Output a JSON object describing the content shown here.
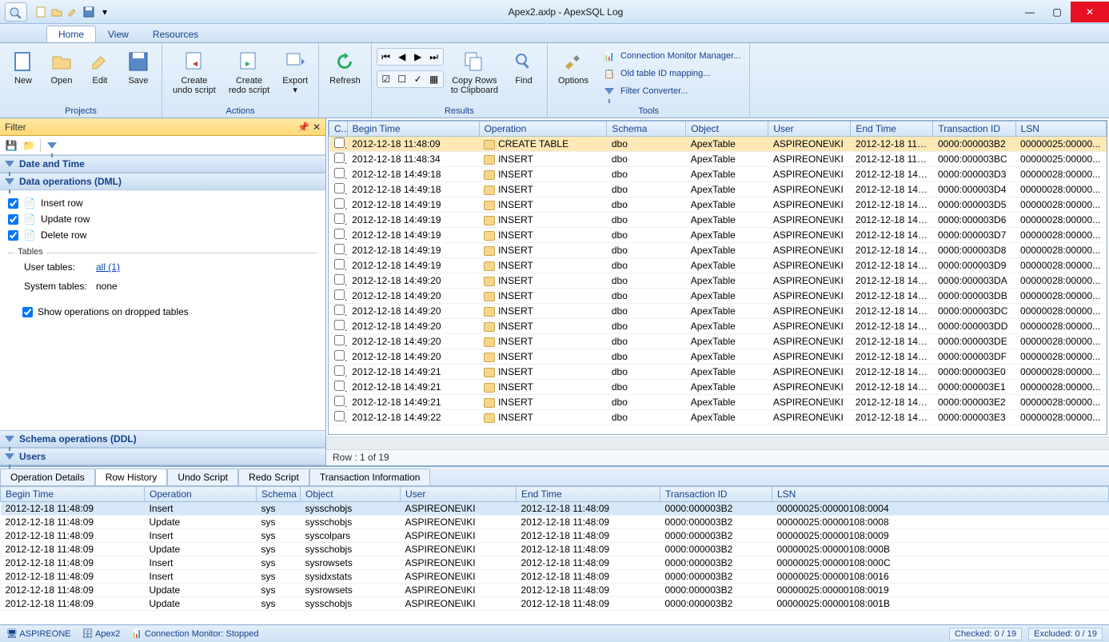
{
  "window": {
    "title": "Apex2.axlp - ApexSQL Log"
  },
  "tabs": [
    {
      "label": "Home",
      "active": true
    },
    {
      "label": "View",
      "active": false
    },
    {
      "label": "Resources",
      "active": false
    }
  ],
  "ribbon": {
    "groups": [
      {
        "label": "Projects",
        "buttons": [
          {
            "label": "New"
          },
          {
            "label": "Open"
          },
          {
            "label": "Edit"
          },
          {
            "label": "Save"
          }
        ]
      },
      {
        "label": "Actions",
        "buttons": [
          {
            "label": "Create\nundo script"
          },
          {
            "label": "Create\nredo script"
          },
          {
            "label": "Export"
          }
        ]
      },
      {
        "label": "",
        "buttons": [
          {
            "label": "Refresh"
          }
        ]
      },
      {
        "label": "Results",
        "buttons": [
          {
            "label": "Copy Rows\nto Clipboard"
          },
          {
            "label": "Find"
          }
        ]
      },
      {
        "label": "Tools",
        "buttons": [
          {
            "label": "Options"
          }
        ],
        "links": [
          {
            "label": "Connection Monitor Manager..."
          },
          {
            "label": "Old table ID mapping..."
          },
          {
            "label": "Filter Converter..."
          }
        ]
      }
    ]
  },
  "filter": {
    "title": "Filter",
    "sections": {
      "date_time": "Date and Time",
      "dml": "Data operations (DML)",
      "ddl": "Schema operations (DDL)",
      "users": "Users"
    },
    "dml_ops": [
      {
        "label": "Insert row",
        "checked": true
      },
      {
        "label": "Update row",
        "checked": true
      },
      {
        "label": "Delete row",
        "checked": true
      }
    ],
    "tables": {
      "label": "Tables",
      "user_tables_key": "User tables:",
      "user_tables_val": "all (1)",
      "system_tables_key": "System tables:",
      "system_tables_val": "none",
      "show_dropped": "Show operations on dropped tables",
      "show_dropped_checked": true
    }
  },
  "grid": {
    "columns": [
      "C...",
      "Begin Time",
      "Operation",
      "Schema",
      "Object",
      "User",
      "End Time",
      "Transaction ID",
      "LSN"
    ],
    "rows": [
      {
        "begin": "2012-12-18 11:48:09",
        "op": "CREATE TABLE",
        "schema": "dbo",
        "object": "ApexTable",
        "user": "ASPIREONE\\IKI",
        "end": "2012-12-18  11:4...",
        "tid": "0000:000003B2",
        "lsn": "00000025:00000...",
        "sel": true
      },
      {
        "begin": "2012-12-18 11:48:34",
        "op": "INSERT",
        "schema": "dbo",
        "object": "ApexTable",
        "user": "ASPIREONE\\IKI",
        "end": "2012-12-18  11:4...",
        "tid": "0000:000003BC",
        "lsn": "00000025:00000..."
      },
      {
        "begin": "2012-12-18 14:49:18",
        "op": "INSERT",
        "schema": "dbo",
        "object": "ApexTable",
        "user": "ASPIREONE\\IKI",
        "end": "2012-12-18  14:4...",
        "tid": "0000:000003D3",
        "lsn": "00000028:00000..."
      },
      {
        "begin": "2012-12-18 14:49:18",
        "op": "INSERT",
        "schema": "dbo",
        "object": "ApexTable",
        "user": "ASPIREONE\\IKI",
        "end": "2012-12-18  14:4...",
        "tid": "0000:000003D4",
        "lsn": "00000028:00000..."
      },
      {
        "begin": "2012-12-18 14:49:19",
        "op": "INSERT",
        "schema": "dbo",
        "object": "ApexTable",
        "user": "ASPIREONE\\IKI",
        "end": "2012-12-18  14:4...",
        "tid": "0000:000003D5",
        "lsn": "00000028:00000..."
      },
      {
        "begin": "2012-12-18 14:49:19",
        "op": "INSERT",
        "schema": "dbo",
        "object": "ApexTable",
        "user": "ASPIREONE\\IKI",
        "end": "2012-12-18  14:4...",
        "tid": "0000:000003D6",
        "lsn": "00000028:00000..."
      },
      {
        "begin": "2012-12-18 14:49:19",
        "op": "INSERT",
        "schema": "dbo",
        "object": "ApexTable",
        "user": "ASPIREONE\\IKI",
        "end": "2012-12-18  14:4...",
        "tid": "0000:000003D7",
        "lsn": "00000028:00000..."
      },
      {
        "begin": "2012-12-18 14:49:19",
        "op": "INSERT",
        "schema": "dbo",
        "object": "ApexTable",
        "user": "ASPIREONE\\IKI",
        "end": "2012-12-18  14:4...",
        "tid": "0000:000003D8",
        "lsn": "00000028:00000..."
      },
      {
        "begin": "2012-12-18 14:49:19",
        "op": "INSERT",
        "schema": "dbo",
        "object": "ApexTable",
        "user": "ASPIREONE\\IKI",
        "end": "2012-12-18  14:4...",
        "tid": "0000:000003D9",
        "lsn": "00000028:00000..."
      },
      {
        "begin": "2012-12-18 14:49:20",
        "op": "INSERT",
        "schema": "dbo",
        "object": "ApexTable",
        "user": "ASPIREONE\\IKI",
        "end": "2012-12-18  14:4...",
        "tid": "0000:000003DA",
        "lsn": "00000028:00000..."
      },
      {
        "begin": "2012-12-18 14:49:20",
        "op": "INSERT",
        "schema": "dbo",
        "object": "ApexTable",
        "user": "ASPIREONE\\IKI",
        "end": "2012-12-18  14:4...",
        "tid": "0000:000003DB",
        "lsn": "00000028:00000..."
      },
      {
        "begin": "2012-12-18 14:49:20",
        "op": "INSERT",
        "schema": "dbo",
        "object": "ApexTable",
        "user": "ASPIREONE\\IKI",
        "end": "2012-12-18  14:4...",
        "tid": "0000:000003DC",
        "lsn": "00000028:00000..."
      },
      {
        "begin": "2012-12-18 14:49:20",
        "op": "INSERT",
        "schema": "dbo",
        "object": "ApexTable",
        "user": "ASPIREONE\\IKI",
        "end": "2012-12-18  14:4...",
        "tid": "0000:000003DD",
        "lsn": "00000028:00000..."
      },
      {
        "begin": "2012-12-18 14:49:20",
        "op": "INSERT",
        "schema": "dbo",
        "object": "ApexTable",
        "user": "ASPIREONE\\IKI",
        "end": "2012-12-18  14:4...",
        "tid": "0000:000003DE",
        "lsn": "00000028:00000..."
      },
      {
        "begin": "2012-12-18 14:49:20",
        "op": "INSERT",
        "schema": "dbo",
        "object": "ApexTable",
        "user": "ASPIREONE\\IKI",
        "end": "2012-12-18  14:4...",
        "tid": "0000:000003DF",
        "lsn": "00000028:00000..."
      },
      {
        "begin": "2012-12-18 14:49:21",
        "op": "INSERT",
        "schema": "dbo",
        "object": "ApexTable",
        "user": "ASPIREONE\\IKI",
        "end": "2012-12-18  14:4...",
        "tid": "0000:000003E0",
        "lsn": "00000028:00000..."
      },
      {
        "begin": "2012-12-18 14:49:21",
        "op": "INSERT",
        "schema": "dbo",
        "object": "ApexTable",
        "user": "ASPIREONE\\IKI",
        "end": "2012-12-18  14:4...",
        "tid": "0000:000003E1",
        "lsn": "00000028:00000..."
      },
      {
        "begin": "2012-12-18 14:49:21",
        "op": "INSERT",
        "schema": "dbo",
        "object": "ApexTable",
        "user": "ASPIREONE\\IKI",
        "end": "2012-12-18  14:4...",
        "tid": "0000:000003E2",
        "lsn": "00000028:00000..."
      },
      {
        "begin": "2012-12-18 14:49:22",
        "op": "INSERT",
        "schema": "dbo",
        "object": "ApexTable",
        "user": "ASPIREONE\\IKI",
        "end": "2012-12-18  14:4...",
        "tid": "0000:000003E3",
        "lsn": "00000028:00000..."
      }
    ],
    "status": "Row : 1 of 19"
  },
  "details": {
    "tabs": [
      "Operation Details",
      "Row History",
      "Undo Script",
      "Redo Script",
      "Transaction Information"
    ],
    "active_tab": 1,
    "columns": [
      "Begin Time",
      "Operation",
      "Schema",
      "Object",
      "User",
      "End Time",
      "Transaction ID",
      "LSN"
    ],
    "rows": [
      {
        "begin": "2012-12-18 11:48:09",
        "op": "Insert",
        "schema": "sys",
        "object": "sysschobjs",
        "user": "ASPIREONE\\IKI",
        "end": "2012-12-18 11:48:09",
        "tid": "0000:000003B2",
        "lsn": "00000025:00000108:0004",
        "sel": true
      },
      {
        "begin": "2012-12-18 11:48:09",
        "op": "Update",
        "schema": "sys",
        "object": "sysschobjs",
        "user": "ASPIREONE\\IKI",
        "end": "2012-12-18 11:48:09",
        "tid": "0000:000003B2",
        "lsn": "00000025:00000108:0008"
      },
      {
        "begin": "2012-12-18 11:48:09",
        "op": "Insert",
        "schema": "sys",
        "object": "syscolpars",
        "user": "ASPIREONE\\IKI",
        "end": "2012-12-18 11:48:09",
        "tid": "0000:000003B2",
        "lsn": "00000025:00000108:0009"
      },
      {
        "begin": "2012-12-18 11:48:09",
        "op": "Update",
        "schema": "sys",
        "object": "sysschobjs",
        "user": "ASPIREONE\\IKI",
        "end": "2012-12-18 11:48:09",
        "tid": "0000:000003B2",
        "lsn": "00000025:00000108:000B"
      },
      {
        "begin": "2012-12-18 11:48:09",
        "op": "Insert",
        "schema": "sys",
        "object": "sysrowsets",
        "user": "ASPIREONE\\IKI",
        "end": "2012-12-18 11:48:09",
        "tid": "0000:000003B2",
        "lsn": "00000025:00000108:000C"
      },
      {
        "begin": "2012-12-18 11:48:09",
        "op": "Insert",
        "schema": "sys",
        "object": "sysidxstats",
        "user": "ASPIREONE\\IKI",
        "end": "2012-12-18 11:48:09",
        "tid": "0000:000003B2",
        "lsn": "00000025:00000108:0016"
      },
      {
        "begin": "2012-12-18 11:48:09",
        "op": "Update",
        "schema": "sys",
        "object": "sysrowsets",
        "user": "ASPIREONE\\IKI",
        "end": "2012-12-18 11:48:09",
        "tid": "0000:000003B2",
        "lsn": "00000025:00000108:0019"
      },
      {
        "begin": "2012-12-18 11:48:09",
        "op": "Update",
        "schema": "sys",
        "object": "sysschobjs",
        "user": "ASPIREONE\\IKI",
        "end": "2012-12-18 11:48:09",
        "tid": "0000:000003B2",
        "lsn": "00000025:00000108:001B"
      }
    ]
  },
  "statusbar": {
    "server": "ASPIREONE",
    "database": "Apex2",
    "monitor": "Connection Monitor: Stopped",
    "checked": "Checked: 0 / 19",
    "excluded": "Excluded: 0 / 19"
  }
}
